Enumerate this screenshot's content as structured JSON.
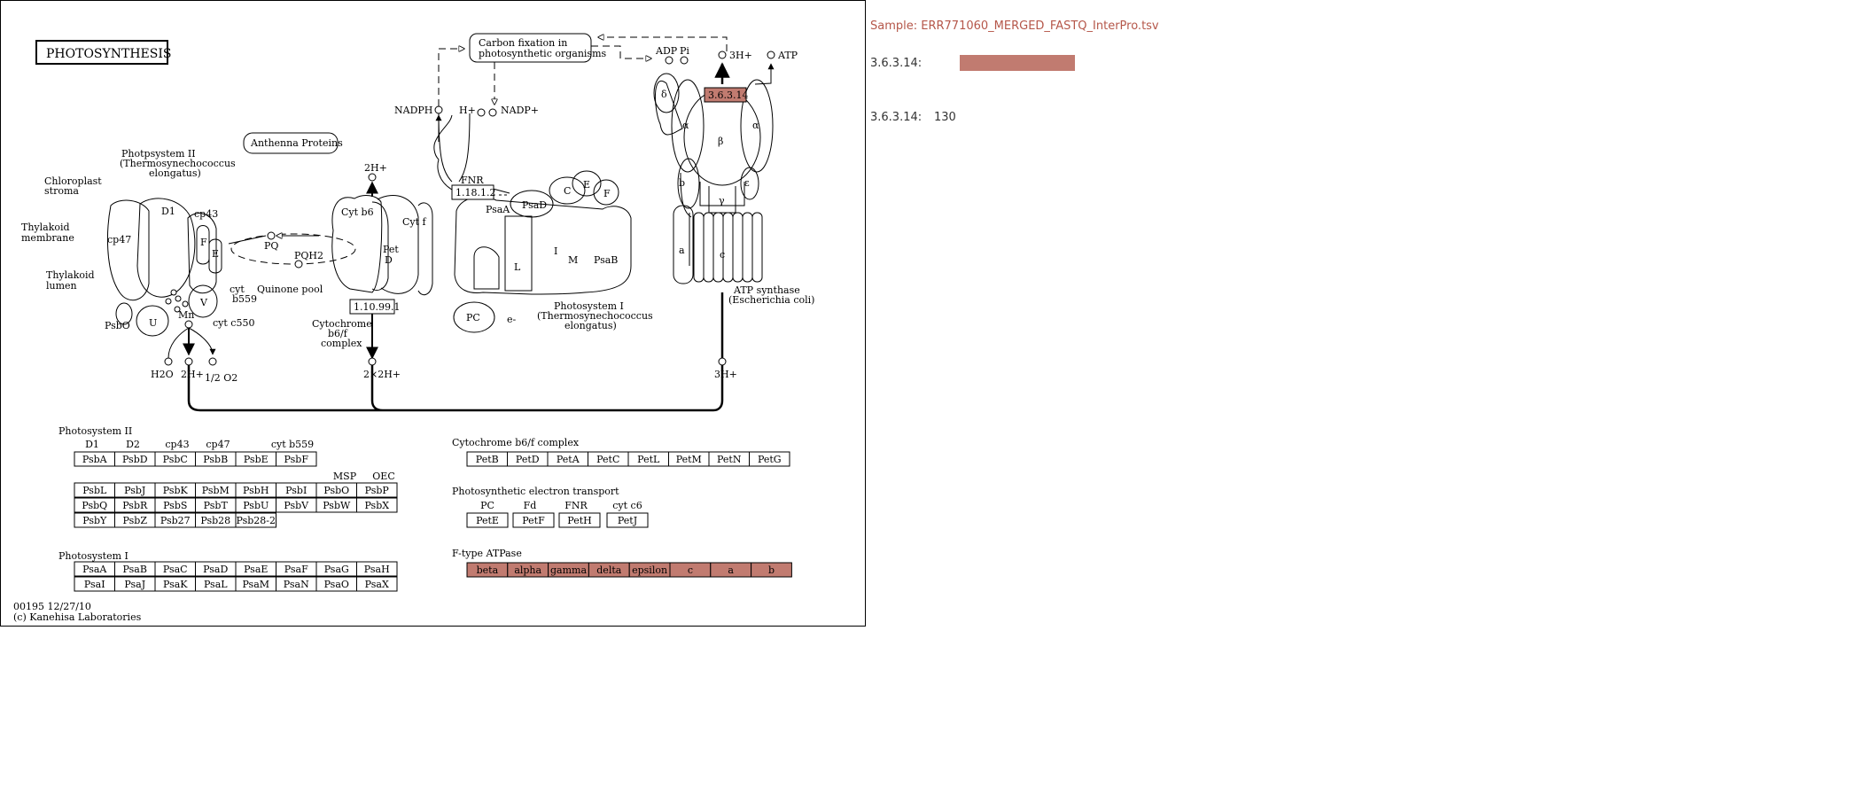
{
  "map": {
    "title": "PHOTOSYNTHESIS",
    "footer_id": "00195 12/27/10",
    "footer_copyright": "(c) Kanehisa Laboratories",
    "colors": {
      "highlight": "#c17b70",
      "stroke": "#000000"
    },
    "compartments": [
      "Chloroplast",
      "stroma",
      "Thylakoid",
      "membrane",
      "Thylakoid",
      "lumen"
    ],
    "labels": {
      "carbon_fixation_1": "Carbon fixation in",
      "carbon_fixation_2": "photosynthetic organisms",
      "antenna": "Anthenna Proteins",
      "ps2_1": "Photpsystem II",
      "ps2_2": "(Thermosynechococcus",
      "ps2_3": "elongatus)",
      "ps1_1": "Photosystem I",
      "ps1_2": "(Thermosynechococcus",
      "ps1_3": "elongatus)",
      "atp_synthase_1": "ATP synthase",
      "atp_synthase_2": "(Escherichia coli)",
      "cyt_complex_1": "Cytochrome",
      "cyt_complex_2": "b6/f",
      "cyt_complex_3": "complex",
      "quinone_pool": "Quinone pool",
      "pq": "PQ",
      "pqh2": "PQH2",
      "nadph": "NADPH",
      "hplus": "H+",
      "nadpplus": "NADP+",
      "adp": "ADP",
      "pi": "Pi",
      "three_h_top": "3H+",
      "atp": "ATP",
      "two_h_top": "2H+",
      "h2o": "H2O",
      "two_h_bottom": "2H+",
      "half_o2": "1/2 O2",
      "two_x_two_h": "2×2H+",
      "three_h_bottom": "3H+",
      "mn": "Mn",
      "cyt_b559_1": "cyt",
      "cyt_b559_2": "b559",
      "cyt_c550": "cyt c550",
      "e_minus": "e-",
      "pc": "PC",
      "cyt_b6": "Cyt b6",
      "cyt_f": "Cyt f",
      "pet_d_1": "Pet",
      "pet_d_2": "D",
      "fnr": "FNR",
      "ec_fnr": "1.18.1.2",
      "ec_cyt": "1.10.99.1",
      "ec_atp": "3.6.3.14",
      "sub_d1": "D1",
      "sub_cp43": "cp43",
      "sub_cp47": "cp47",
      "sub_f": "F",
      "sub_e": "E",
      "sub_v": "V",
      "sub_u": "U",
      "sub_psbo": "PsbO",
      "sub_psaa": "PsaA",
      "sub_psad": "PsaD",
      "sub_c": "C",
      "sub_e1": "E",
      "sub_f1": "F",
      "sub_l": "L",
      "sub_i": "I",
      "sub_m": "M",
      "sub_psab": "PsaB",
      "sub_delta": "δ",
      "sub_alpha1": "α",
      "sub_beta": "β",
      "sub_alpha2": "α",
      "sub_b": "b",
      "sub_gamma": "γ",
      "sub_epsilon": "ε",
      "sub_a": "a",
      "sub_c_ring": "c"
    },
    "tables": {
      "ps2": {
        "heading": "Photosystem II",
        "group_labels": [
          "D1",
          "D2",
          "cp43",
          "cp47",
          "cyt b559"
        ],
        "row1": [
          "PsbA",
          "PsbD",
          "PsbC",
          "PsbB",
          "PsbE",
          "PsbF"
        ],
        "group_labels2": [
          "MSP",
          "OEC"
        ],
        "row2": [
          "PsbL",
          "PsbJ",
          "PsbK",
          "PsbM",
          "PsbH",
          "PsbI",
          "PsbO",
          "PsbP"
        ],
        "row3": [
          "PsbQ",
          "PsbR",
          "PsbS",
          "PsbT",
          "PsbU",
          "PsbV",
          "PsbW",
          "PsbX"
        ],
        "row4": [
          "PsbY",
          "PsbZ",
          "Psb27",
          "Psb28",
          "Psb28-2"
        ]
      },
      "ps1": {
        "heading": "Photosystem I",
        "row1": [
          "PsaA",
          "PsaB",
          "PsaC",
          "PsaD",
          "PsaE",
          "PsaF",
          "PsaG",
          "PsaH"
        ],
        "row2": [
          "PsaI",
          "PsaJ",
          "PsaK",
          "PsaL",
          "PsaM",
          "PsaN",
          "PsaO",
          "PsaX"
        ]
      },
      "cytb6f": {
        "heading": "Cytochrome b6/f complex",
        "row1": [
          "PetB",
          "PetD",
          "PetA",
          "PetC",
          "PetL",
          "PetM",
          "PetN",
          "PetG"
        ]
      },
      "pet": {
        "heading": "Photosynthetic electron transport",
        "group_labels": [
          "PC",
          "Fd",
          "FNR",
          "cyt c6"
        ],
        "row1": [
          "PetE",
          "PetF",
          "PetH",
          "PetJ"
        ]
      },
      "atpase": {
        "heading": "F-type ATPase",
        "row1": [
          "beta",
          "alpha",
          "gamma",
          "delta",
          "epsilon",
          "c",
          "a",
          "b"
        ],
        "highlighted": true
      }
    }
  },
  "legend": {
    "sample_title": "Sample: ERR771060_MERGED_FASTQ_InterPro.tsv",
    "bar_label": "3.6.3.14:",
    "count_label": "3.6.3.14:",
    "count_value": "130",
    "bar_color": "#c17b70",
    "title_color": "#b5574a"
  }
}
